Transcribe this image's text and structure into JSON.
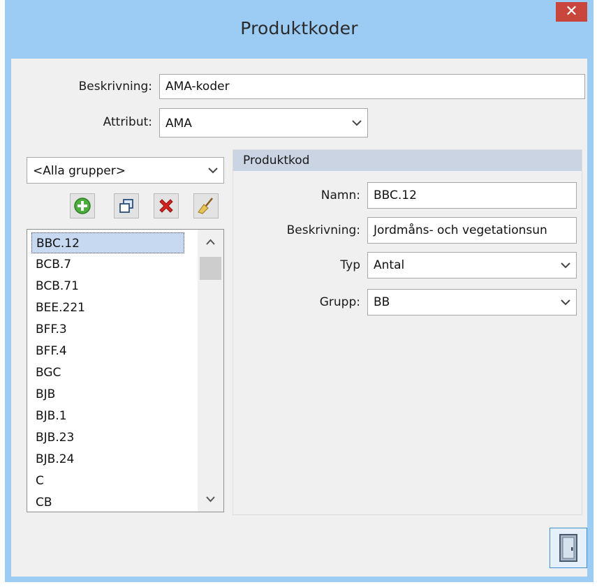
{
  "window": {
    "title": "Produktkoder",
    "close_label": "✕"
  },
  "form": {
    "description_label": "Beskrivning:",
    "description_value": "AMA-koder",
    "attribute_label": "Attribut:",
    "attribute_value": "AMA"
  },
  "group_filter": {
    "value": "<Alla grupper>"
  },
  "toolbar": {
    "buttons": [
      {
        "icon": "add-icon"
      },
      {
        "icon": "copy-icon"
      },
      {
        "icon": "delete-icon"
      },
      {
        "icon": "broom-icon"
      }
    ]
  },
  "code_list": {
    "items": [
      "BBC.12",
      "BCB.7",
      "BCB.71",
      "BEE.221",
      "BFF.3",
      "BFF.4",
      "BGC",
      "BJB",
      "BJB.1",
      "BJB.23",
      "BJB.24",
      "C",
      "CB"
    ],
    "selected": "BBC.12"
  },
  "detail": {
    "header": "Produktkod",
    "name_label": "Namn:",
    "name_value": "BBC.12",
    "description_label": "Beskrivning:",
    "description_value": "Jordmåns- och vegetationsun",
    "type_label": "Typ",
    "type_value": "Antal",
    "group_label": "Grupp:",
    "group_value": "BB"
  },
  "footer": {
    "exit_icon": "door-exit-icon"
  },
  "colors": {
    "titlebar": "#9ccbf3",
    "close": "#c9463d",
    "selection": "#c7d8f1",
    "panel_header": "#cad4e2"
  }
}
